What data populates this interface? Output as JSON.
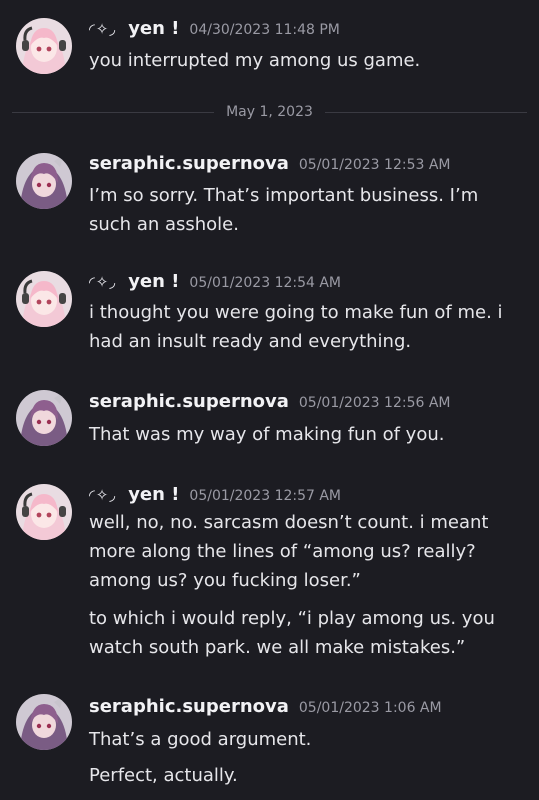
{
  "users": {
    "yen": {
      "name": "yen !",
      "name_deco": "◜✧◞"
    },
    "seraphic": {
      "name": "seraphic.supernova"
    }
  },
  "date_divider": "May 1, 2023",
  "messages": [
    {
      "timestamp": "04/30/2023 11:48 PM",
      "lines": [
        "you interrupted my among us game."
      ]
    },
    {
      "timestamp": "05/01/2023 12:53 AM",
      "lines": [
        "I’m so sorry. That’s important business. I’m such an asshole."
      ]
    },
    {
      "timestamp": "05/01/2023 12:54 AM",
      "lines": [
        "i thought you were going to make fun of me. i had an insult ready and everything."
      ]
    },
    {
      "timestamp": "05/01/2023 12:56 AM",
      "lines": [
        "That was my way of making fun of you."
      ]
    },
    {
      "timestamp": "05/01/2023 12:57 AM",
      "lines": [
        "well, no, no. sarcasm doesn’t count. i meant more along the lines of “among us? really? among us? you fucking loser.”",
        "to which i would reply, “i play among us. you watch south park. we all make mistakes.”"
      ]
    },
    {
      "timestamp": "05/01/2023 1:06 AM",
      "lines": [
        "That’s a good argument.",
        "Perfect, actually."
      ]
    }
  ],
  "colors": {
    "background": "#1c1c22",
    "text": "#e6e6ea",
    "timestamp": "#9a9aa4",
    "divider": "#3a3a42"
  }
}
